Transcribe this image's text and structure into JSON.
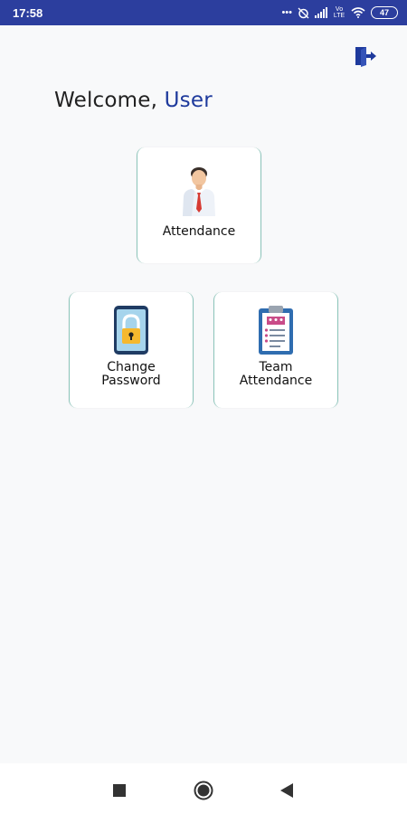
{
  "status_bar": {
    "time": "17:58",
    "network_label": "Vo LTE",
    "battery": "47",
    "icons": [
      "more-dots-icon",
      "alarm-icon",
      "signal-icon",
      "volte-icon",
      "wifi-icon",
      "battery-icon"
    ]
  },
  "header": {
    "logout_icon": "logout-icon",
    "greeting": "Welcome,",
    "username": "User"
  },
  "tiles": [
    {
      "label": "Attendance",
      "icon": "employee-icon"
    },
    {
      "label_line1": "Change",
      "label_line2": "Password",
      "icon": "lock-icon"
    },
    {
      "label_line1": "Team",
      "label_line2": "Attendance",
      "icon": "clipboard-icon"
    }
  ],
  "nav_bar": {
    "icons": [
      "recents-square-icon",
      "home-circle-icon",
      "back-triangle-icon"
    ]
  },
  "colors": {
    "status_bar": "#2c3e9e",
    "accent": "#1e3a9c",
    "background": "#f8f9fa",
    "tile_border": "#8cc5ba"
  }
}
